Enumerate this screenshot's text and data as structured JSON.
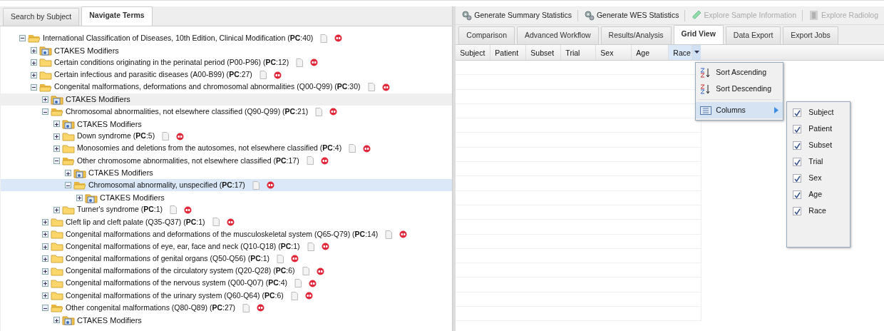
{
  "left_tabs": [
    {
      "label": "Search by Subject",
      "selected": false
    },
    {
      "label": "Navigate Terms",
      "selected": true
    }
  ],
  "tree": [
    {
      "kind": "term",
      "label": "International Classification of Diseases, 10th Edition, Clinical Modification (**PC**:40)",
      "expanded": true,
      "selected": false,
      "hovered": false,
      "children": [
        {
          "kind": "modifiers",
          "label": "CTAKES Modifiers",
          "expanded": false,
          "selected": false,
          "hovered": false
        },
        {
          "kind": "term",
          "label": "Certain conditions originating in the perinatal period (P00-P96) (**PC**:12)",
          "expanded": false,
          "selected": false,
          "hovered": false
        },
        {
          "kind": "term",
          "label": "Certain infectious and parasitic diseases (A00-B99) (**PC**:27)",
          "expanded": false,
          "selected": false,
          "hovered": false
        },
        {
          "kind": "term",
          "label": "Congenital malformations, deformations and chromosomal abnormalities (Q00-Q99) (**PC**:30)",
          "expanded": true,
          "selected": false,
          "hovered": false,
          "children": [
            {
              "kind": "modifiers",
              "label": "CTAKES Modifiers",
              "expanded": false,
              "selected": false,
              "hovered": true
            },
            {
              "kind": "term",
              "label": "Chromosomal abnormalities, not elsewhere classified (Q90-Q99) (**PC**:21)",
              "expanded": true,
              "selected": false,
              "hovered": false,
              "children": [
                {
                  "kind": "modifiers",
                  "label": "CTAKES Modifiers",
                  "expanded": false,
                  "selected": false,
                  "hovered": false
                },
                {
                  "kind": "term",
                  "label": "Down syndrome (**PC**:5)",
                  "expanded": false,
                  "selected": false,
                  "hovered": false
                },
                {
                  "kind": "term",
                  "label": "Monosomies and deletions from the autosomes, not elsewhere classified (**PC**:4)",
                  "expanded": false,
                  "selected": false,
                  "hovered": false
                },
                {
                  "kind": "term",
                  "label": "Other chromosome abnormalities, not elsewhere classified (**PC**:17)",
                  "expanded": true,
                  "selected": false,
                  "hovered": false,
                  "children": [
                    {
                      "kind": "modifiers",
                      "label": "CTAKES Modifiers",
                      "expanded": false,
                      "selected": false,
                      "hovered": false
                    },
                    {
                      "kind": "term",
                      "label": "Chromosomal abnormality, unspecified (**PC**:17)",
                      "expanded": true,
                      "selected": true,
                      "hovered": false,
                      "children": [
                        {
                          "kind": "modifiers",
                          "label": "CTAKES Modifiers",
                          "expanded": false,
                          "selected": false,
                          "hovered": false
                        }
                      ]
                    }
                  ]
                },
                {
                  "kind": "term",
                  "label": "Turner's syndrome (**PC**:1)",
                  "expanded": false,
                  "selected": false,
                  "hovered": false
                }
              ]
            },
            {
              "kind": "term",
              "label": "Cleft lip and cleft palate (Q35-Q37) (**PC**:1)",
              "expanded": false,
              "selected": false,
              "hovered": false
            },
            {
              "kind": "term",
              "label": "Congenital malformations and deformations of the musculoskeletal system (Q65-Q79) (**PC**:14)",
              "expanded": false,
              "selected": false,
              "hovered": false
            },
            {
              "kind": "term",
              "label": "Congenital malformations of eye, ear, face and neck (Q10-Q18) (**PC**:1)",
              "expanded": false,
              "selected": false,
              "hovered": false
            },
            {
              "kind": "term",
              "label": "Congenital malformations of genital organs (Q50-Q56) (**PC**:1)",
              "expanded": false,
              "selected": false,
              "hovered": false
            },
            {
              "kind": "term",
              "label": "Congenital malformations of the circulatory system (Q20-Q28) (**PC**:6)",
              "expanded": false,
              "selected": false,
              "hovered": false
            },
            {
              "kind": "term",
              "label": "Congenital malformations of the nervous system (Q00-Q07) (**PC**:4)",
              "expanded": false,
              "selected": false,
              "hovered": false
            },
            {
              "kind": "term",
              "label": "Congenital malformations of the urinary system (Q60-Q64) (**PC**:6)",
              "expanded": false,
              "selected": false,
              "hovered": false
            },
            {
              "kind": "term",
              "label": "Other congenital malformations (Q80-Q89) (**PC**:27)",
              "expanded": true,
              "selected": false,
              "hovered": false,
              "children": [
                {
                  "kind": "modifiers",
                  "label": "CTAKES Modifiers",
                  "expanded": false,
                  "selected": false,
                  "hovered": false
                }
              ]
            }
          ]
        }
      ]
    }
  ],
  "toolbar": [
    {
      "kind": "gear",
      "label": "Generate Summary Statistics",
      "disabled": false
    },
    {
      "kind": "gear",
      "label": "Generate WES Statistics",
      "disabled": false
    },
    {
      "kind": "tube",
      "label": "Explore Sample Information",
      "disabled": true
    },
    {
      "kind": "film",
      "label": "Explore Radiolog",
      "disabled": true
    }
  ],
  "right_tabs": [
    {
      "label": "Comparison",
      "selected": false
    },
    {
      "label": "Advanced Workflow",
      "selected": false
    },
    {
      "label": "Results/Analysis",
      "selected": false
    },
    {
      "label": "Grid View",
      "selected": true
    },
    {
      "label": "Data Export",
      "selected": false
    },
    {
      "label": "Export Jobs",
      "selected": false
    }
  ],
  "grid": {
    "columns": [
      {
        "label": "Subject",
        "selected": false
      },
      {
        "label": "Patient",
        "selected": false
      },
      {
        "label": "Subset",
        "selected": false
      },
      {
        "label": "Trial",
        "selected": false
      },
      {
        "label": "Sex",
        "selected": false
      },
      {
        "label": "Age",
        "selected": false
      },
      {
        "label": "Race",
        "selected": true
      }
    ]
  },
  "column_menu": {
    "items": [
      {
        "kind": "sort-asc",
        "label": "Sort Ascending",
        "active": false
      },
      {
        "kind": "sort-desc",
        "label": "Sort Descending",
        "active": false
      },
      {
        "kind": "columns",
        "label": "Columns",
        "active": true
      }
    ],
    "submenu": [
      {
        "label": "Subject",
        "checked": true
      },
      {
        "label": "Patient",
        "checked": true
      },
      {
        "label": "Subset",
        "checked": true
      },
      {
        "label": "Trial",
        "checked": true
      },
      {
        "label": "Sex",
        "checked": true
      },
      {
        "label": "Age",
        "checked": true
      },
      {
        "label": "Race",
        "checked": true
      }
    ]
  }
}
